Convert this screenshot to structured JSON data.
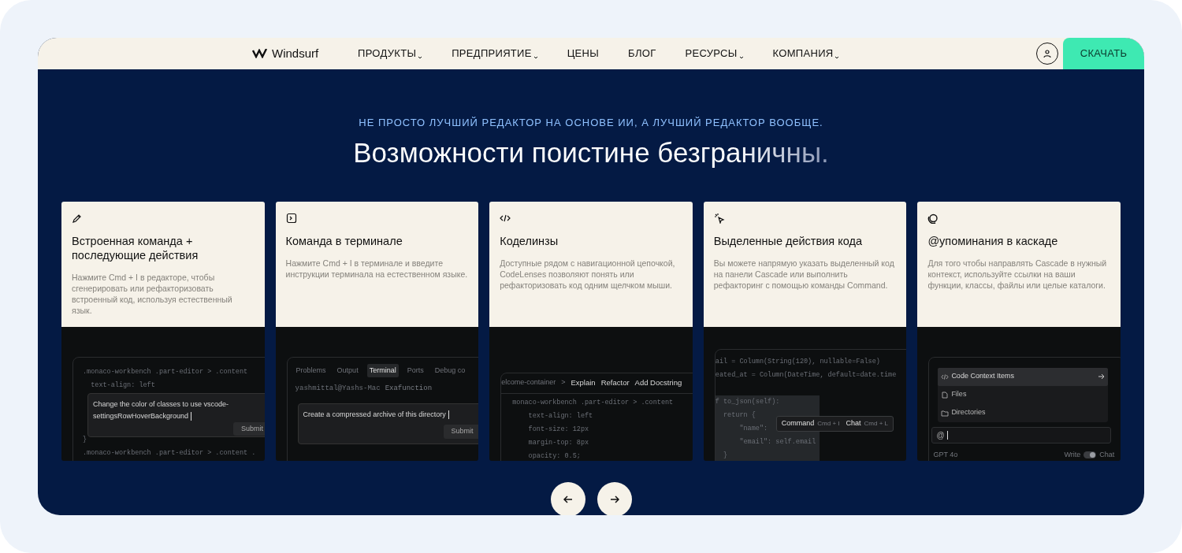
{
  "nav": {
    "brand": "Windsurf",
    "items": [
      {
        "label": "ПРОДУКТЫ",
        "dropdown": true
      },
      {
        "label": "ПРЕДПРИЯТИЕ",
        "dropdown": true
      },
      {
        "label": "ЦЕНЫ",
        "dropdown": false
      },
      {
        "label": "БЛОГ",
        "dropdown": false
      },
      {
        "label": "РЕСУРСЫ",
        "dropdown": true
      },
      {
        "label": "КОМПАНИЯ",
        "dropdown": true
      }
    ],
    "download": "СКАЧАТЬ"
  },
  "hero": {
    "eyebrow": "НЕ ПРОСТО ЛУЧШИЙ РЕДАКТОР НА ОСНОВЕ ИИ, А ЛУЧШИЙ РЕДАКТОР ВООБЩЕ.",
    "title": "Возможности поистине безграничны."
  },
  "cards": [
    {
      "title": "Встроенная команда + последующие действия",
      "text": "Нажмите Cmd + I в редакторе, чтобы сгенерировать или рефакторизовать встроенный код, используя естественный язык.",
      "preview": {
        "kind": "inline",
        "code": [
          ".monaco-workbench .part-editor > .content",
          "  text-align: left"
        ],
        "code_after": [
          "}",
          ".monaco-workbench .part-editor > .content ."
        ],
        "prompt": "Change the color of classes to use vscode-settingsRowHoverBackground",
        "submit": "Submit"
      }
    },
    {
      "title": "Команда в терминале",
      "text": "Нажмите Cmd + I в терминале и введите инструкции терминала на естественном языке.",
      "preview": {
        "kind": "terminal",
        "tabs": [
          {
            "label": "Problems",
            "selected": false
          },
          {
            "label": "Output",
            "selected": false
          },
          {
            "label": "Terminal",
            "selected": true
          },
          {
            "label": "Ports",
            "selected": false
          },
          {
            "label": "Debug co",
            "selected": false
          }
        ],
        "host": "yashmittal@Yashs-Mac",
        "dir": "Exafunction",
        "prompt": "Create a compressed archive of this directory",
        "submit": "Submit"
      }
    },
    {
      "title": "Коделинзы",
      "text": "Доступные рядом с навигационной цепочкой, CodeLenses позволяют понять или рефакторизовать код одним щелчком мыши.",
      "preview": {
        "kind": "codelens",
        "crumb": "elcome-container",
        "sep": ">",
        "actions": [
          "Explain",
          "Refactor",
          "Add Docstring"
        ],
        "code": [
          "monaco-workbench .part-editor > .content",
          "    text-align: left",
          "    font-size: 12px",
          "    margin-top: 8px",
          "    opacity: 0.5;"
        ]
      }
    },
    {
      "title": "Выделенные действия кода",
      "text": "Вы можете напрямую указать выделенный код на панели Cascade или выполнить рефакторинг с помощью команды Command.",
      "preview": {
        "kind": "selection",
        "code": [
          {
            "text": "ail = Column(String(120), nullable=False)",
            "selected": false
          },
          {
            "text": "eated_at = Column(DateTime, default=date.time",
            "selected": false
          },
          {
            "text": "f to_json(self):",
            "selected": true
          },
          {
            "text": "  return {",
            "selected": true
          },
          {
            "text": "      \"name\":",
            "selected": true
          },
          {
            "text": "      \"email\": self.email",
            "selected": true
          },
          {
            "text": "  }",
            "selected": true
          }
        ],
        "popup": [
          {
            "label": "Command",
            "keys": "Cmd + I"
          },
          {
            "label": "Chat",
            "keys": "Cmd + L"
          }
        ]
      }
    },
    {
      "title": "@упоминания в каскаде",
      "text": "Для того чтобы направлять Cascade в нужный контекст, используйте ссылки на ваши функции, классы, файлы или целые каталоги.",
      "preview": {
        "kind": "mentions",
        "items": [
          {
            "label": "Code Context Items",
            "selected": true
          },
          {
            "label": "Files",
            "selected": false
          },
          {
            "label": "Directories",
            "selected": false
          }
        ],
        "input": "@",
        "model": "GPT 4o",
        "modes": [
          "Write",
          "Chat"
        ],
        "chat_mode": true
      }
    }
  ]
}
